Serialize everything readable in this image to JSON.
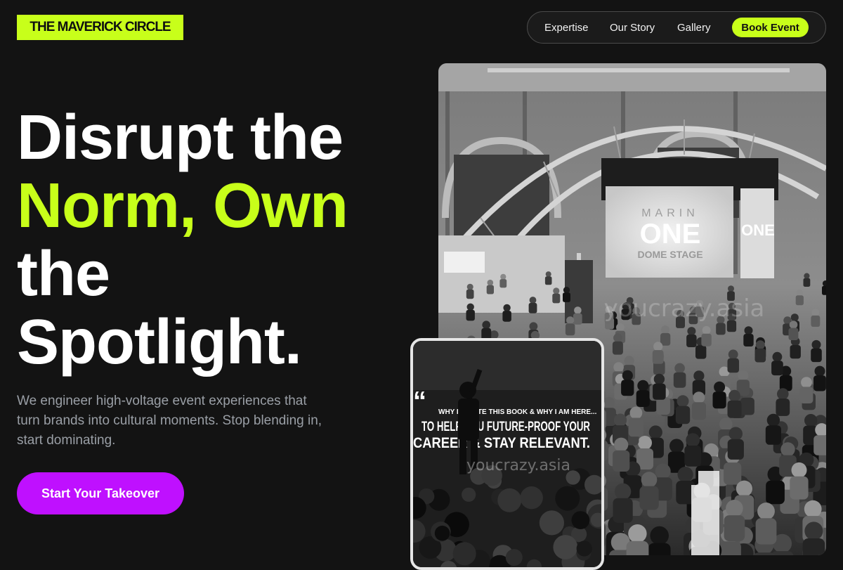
{
  "header": {
    "logo_text": "THE MAVERICK CIRCLE",
    "nav": {
      "links": [
        "Expertise",
        "Our Story",
        "Gallery"
      ],
      "cta": "Book Event"
    }
  },
  "hero": {
    "title_lines": [
      "Disrupt the",
      "Norm, Own",
      "the",
      "Spotlight."
    ],
    "subtitle": "We engineer high-voltage event experiences that turn brands into cultural moments. Stop blending in, start dominating.",
    "button": "Start Your Takeover"
  },
  "images": {
    "main_screen_lines": [
      "MARIN",
      "ONE",
      "DOME STAGE"
    ],
    "main_side_banner": "ONE",
    "card_banner_lines": [
      "WHY I WROTE THIS BOOK & WHY I AM HERE...",
      "TO HELP YOU FUTURE-PROOF YOUR",
      "CAREER & STAY RELEVANT."
    ],
    "watermark": "youcrazy.asia"
  },
  "colors": {
    "accent": "#c8ff1a",
    "button": "#bf10ff",
    "background": "#131313"
  }
}
